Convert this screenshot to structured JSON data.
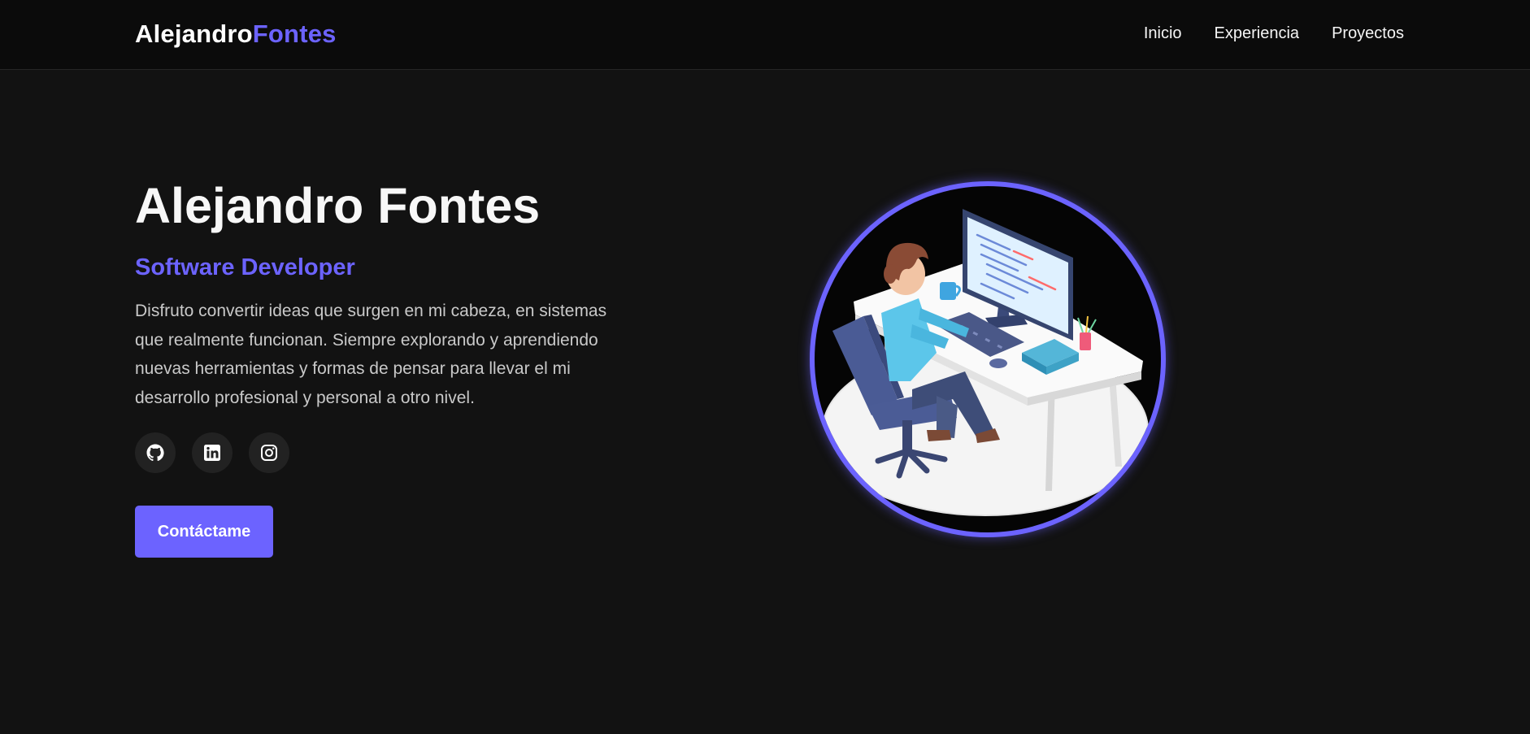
{
  "nav": {
    "brand_first": "Alejandro",
    "brand_last": "Fontes",
    "links": [
      "Inicio",
      "Experiencia",
      "Proyectos"
    ]
  },
  "hero": {
    "name": "Alejandro Fontes",
    "role": "Software Developer",
    "description": "Disfruto convertir ideas que surgen en mi cabeza, en sistemas que realmente funcionan. Siempre explorando y aprendiendo nuevas herramientas y formas de pensar para llevar el mi desarrollo profesional y personal a otro nivel.",
    "socials": [
      {
        "icon": "github-icon"
      },
      {
        "icon": "linkedin-icon"
      },
      {
        "icon": "instagram-icon"
      }
    ],
    "cta_label": "Contáctame",
    "illustration": "developer-at-desk-illustration"
  },
  "colors": {
    "accent": "#6c63ff",
    "background": "#121212",
    "navbar": "#0b0b0b",
    "social_bg": "#222222"
  }
}
